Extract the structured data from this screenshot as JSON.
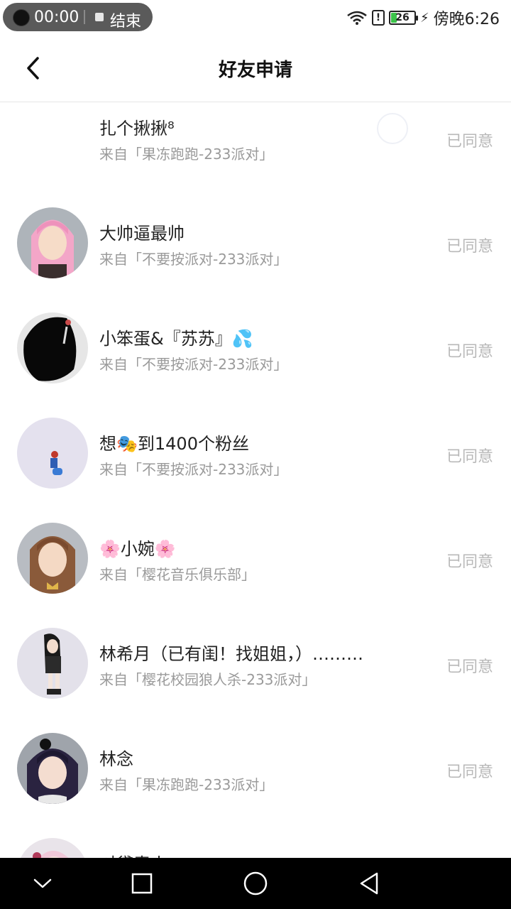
{
  "status_bar": {
    "recording_time": "00:00",
    "recording_end_label": "结束",
    "battery_level": "26",
    "clock": "傍晚6:26"
  },
  "header": {
    "title": "好友申请"
  },
  "requests": [
    {
      "name": "扎个揪揪⁸",
      "source": "来自「果冻跑跑-233派对」",
      "status": "已同意"
    },
    {
      "name": "大帅逼最帅",
      "source": "来自「不要按派对-233派对」",
      "status": "已同意"
    },
    {
      "name": "小笨蛋&『苏苏』💦",
      "source": "来自「不要按派对-233派对」",
      "status": "已同意"
    },
    {
      "name": "想🎭到1400个粉丝",
      "source": "来自「不要按派对-233派对」",
      "status": "已同意"
    },
    {
      "name": "🌸小婉🌸",
      "source": "来自「樱花音乐俱乐部」",
      "status": "已同意"
    },
    {
      "name": "林希月（已有闺！找姐姐，）………",
      "source": "来自「樱花校园狼人杀-233派对」",
      "status": "已同意"
    },
    {
      "name": "林念",
      "source": "来自「果冻跑跑-233派对」",
      "status": "已同意"
    },
    {
      "name": "对黛青山",
      "source": "",
      "status": ""
    }
  ]
}
